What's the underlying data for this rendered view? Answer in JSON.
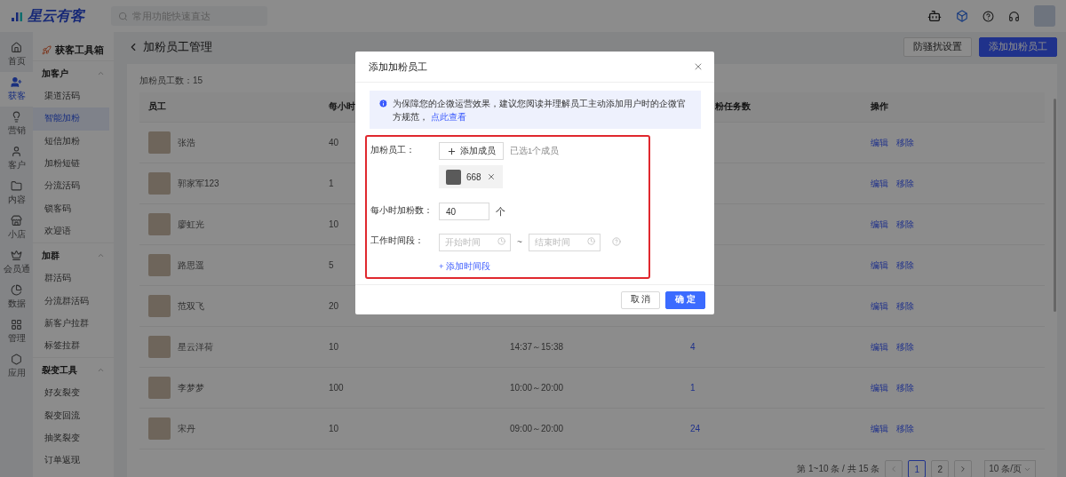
{
  "app": {
    "logo": "星云有客",
    "search_placeholder": "常用功能快速直达"
  },
  "rail": [
    {
      "label": "首页",
      "selected": false
    },
    {
      "label": "获客",
      "selected": true
    },
    {
      "label": "营销",
      "selected": false
    },
    {
      "label": "客户",
      "selected": false
    },
    {
      "label": "内容",
      "selected": false
    },
    {
      "label": "小店",
      "selected": false
    },
    {
      "label": "会员通",
      "selected": false
    },
    {
      "label": "数据",
      "selected": false
    },
    {
      "label": "管理",
      "selected": false
    },
    {
      "label": "应用",
      "selected": false
    }
  ],
  "toolbox": {
    "title": "获客工具箱",
    "groups": [
      {
        "title": "加客户",
        "expanded": true,
        "items": [
          {
            "label": "渠道活码",
            "selected": false
          },
          {
            "label": "智能加粉",
            "selected": true
          },
          {
            "label": "短信加粉",
            "selected": false
          },
          {
            "label": "加粉短链",
            "selected": false
          },
          {
            "label": "分流活码",
            "selected": false
          },
          {
            "label": "锁客码",
            "selected": false
          },
          {
            "label": "欢迎语",
            "selected": false
          }
        ]
      },
      {
        "title": "加群",
        "expanded": true,
        "items": [
          {
            "label": "群活码",
            "selected": false
          },
          {
            "label": "分流群活码",
            "selected": false
          },
          {
            "label": "新客户拉群",
            "selected": false
          },
          {
            "label": "标签拉群",
            "selected": false
          }
        ]
      },
      {
        "title": "裂变工具",
        "expanded": true,
        "items": [
          {
            "label": "好友裂变",
            "selected": false
          },
          {
            "label": "裂变回流",
            "selected": false
          },
          {
            "label": "抽奖裂变",
            "selected": false
          },
          {
            "label": "订单返现",
            "selected": false
          }
        ]
      }
    ]
  },
  "page": {
    "title": "加粉员工管理",
    "buttons": [
      {
        "label": "防骚扰设置",
        "kind": "default"
      },
      {
        "label": "添加加粉员工",
        "kind": "primary"
      }
    ],
    "count": "加粉员工数：15"
  },
  "table": {
    "columns": {
      "employee": "员工",
      "column_2": "每小时",
      "column_4": "粉任务数",
      "actions": "操作"
    },
    "rows": [
      {
        "name": "张浩",
        "hourly": "40",
        "actions": [
          "编辑",
          "移除"
        ]
      },
      {
        "name": "郭家军123",
        "hourly": "1",
        "actions": [
          "编辑",
          "移除"
        ]
      },
      {
        "name": "廖虹光",
        "hourly": "10",
        "actions": [
          "编辑",
          "移除"
        ]
      },
      {
        "name": "路思遥",
        "hourly": "5",
        "actions": [
          "编辑",
          "移除"
        ]
      },
      {
        "name": "范双飞",
        "hourly": "20",
        "actions": [
          "编辑",
          "移除"
        ]
      },
      {
        "name": "星云洋荷",
        "hourly": "10",
        "time": "14:37～15:38",
        "tasks": "4",
        "actions": [
          "编辑",
          "移除"
        ]
      },
      {
        "name": "李梦梦",
        "hourly": "100",
        "time": "10:00～20:00",
        "tasks": "1",
        "actions": [
          "编辑",
          "移除"
        ]
      },
      {
        "name": "宋丹",
        "hourly": "10",
        "time": "09:00～20:00",
        "tasks": "24",
        "actions": [
          "编辑",
          "移除"
        ]
      }
    ]
  },
  "pagination": {
    "summary": "第 1~10 条 / 共 15 条",
    "pages": [
      {
        "label": "1",
        "selected": true
      },
      {
        "label": "2",
        "selected": false
      }
    ],
    "page_size": "10 条/页"
  },
  "modal": {
    "title": "添加加粉员工",
    "notice": "为保障您的企微运营效果，建议您阅读并理解员工主动添加用户时的企微官方规范，",
    "notice_link": "点此查看",
    "member_label": "加粉员工：",
    "add_member": "添加成员",
    "selected_count": "已选1个成员",
    "members": [
      {
        "name": "668"
      }
    ],
    "hourly_label": "每小时加粉数：",
    "hourly_value": "40",
    "hourly_unit": "个",
    "time_label": "工作时间段：",
    "start_placeholder": "开始时间",
    "separator": "~",
    "end_placeholder": "结束时间",
    "add_time": "+ 添加时间段",
    "cancel": "取 消",
    "confirm": "确 定"
  }
}
